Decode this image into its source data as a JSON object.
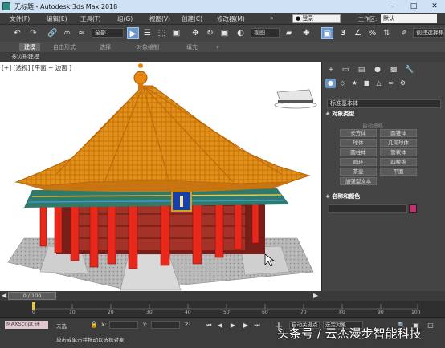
{
  "window": {
    "doc_title": "无标题",
    "separator": "-",
    "app_title": "Autodesk 3ds Max 2018",
    "min_icon": "minimize-icon",
    "max_icon": "maximize-icon",
    "close_icon": "close-icon"
  },
  "menubar": {
    "items": [
      "文件(F)",
      "编辑(E)",
      "工具(T)",
      "组(G)",
      "视图(V)",
      "创建(C)",
      "修改器(M)"
    ],
    "more": "»",
    "login": "登录",
    "workspace_label": "工作区:",
    "workspace_value": "默认"
  },
  "toolbar": {
    "selection_filter": "全部",
    "reference_coord": "视图",
    "named_set": "创建选择集",
    "angle_snap_label": "3"
  },
  "ribbon": {
    "tabs": [
      "建模",
      "自由形式",
      "选择",
      "对象绘制",
      "填充"
    ],
    "subtab": "多边形建模"
  },
  "viewport": {
    "label": "[+] [透视] [平面 + 边面 ]"
  },
  "command_panel": {
    "category": "标准基本体",
    "object_type_header": "对象类型",
    "autogrid": "自动栅格",
    "buttons": [
      "长方体",
      "圆锥体",
      "球体",
      "几何球体",
      "圆柱体",
      "管状体",
      "圆环",
      "四棱锥",
      "茶壶",
      "平面",
      "加强型文本"
    ],
    "name_color_header": "名称和颜色",
    "collapse_glyph": "+",
    "swatch_color": "#c0326e"
  },
  "timeline": {
    "current": "0 / 100",
    "ticks": [
      "0",
      "10",
      "20",
      "30",
      "40",
      "50",
      "60",
      "70",
      "80",
      "90",
      "100"
    ]
  },
  "statusbar": {
    "maxscript": "MAXScript 迷",
    "selection_status": "未选",
    "prompt": "单击或单击并拖动以选择对象",
    "x_label": "X:",
    "y_label": "Y:",
    "z_label": "Z:",
    "auto_key": "自动关键点",
    "set_key_filter": "选定对象"
  },
  "watermark": "头条号 / 云杰漫步智能科技"
}
